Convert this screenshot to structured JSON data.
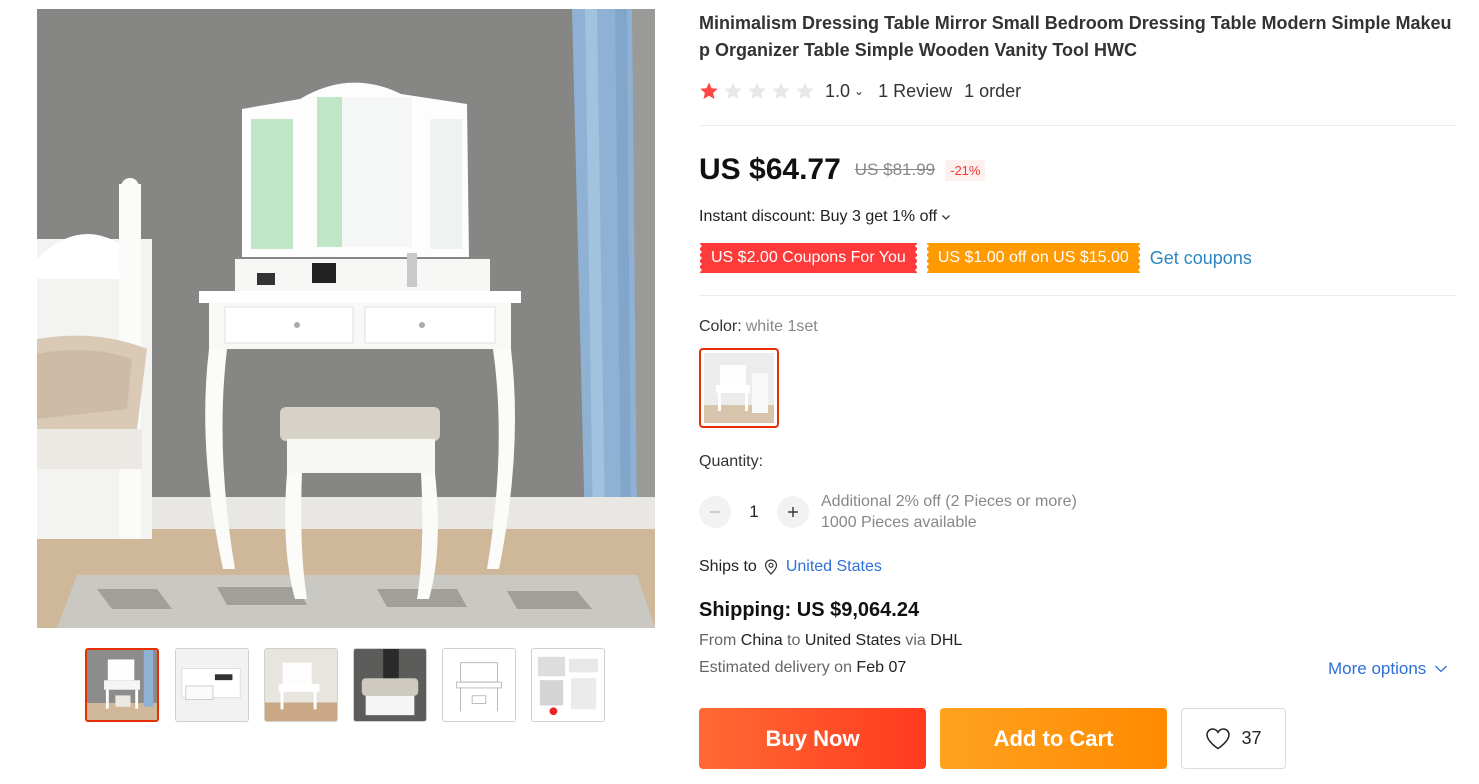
{
  "product": {
    "title": "Minimalism Dressing Table Mirror Small Bedroom Dressing Table Modern Simple Makeup Organizer Table Simple Wooden Vanity Tool HWC",
    "rating": {
      "value": "1.0",
      "stars_filled": 1,
      "stars_total": 5,
      "reviews_label": "1 Review",
      "orders_label": "1 order"
    },
    "price": {
      "current": "US $64.77",
      "original": "US $81.99",
      "discount": "-21%"
    },
    "instant_discount": "Instant discount: Buy 3 get 1% off",
    "coupons": [
      {
        "label": "US $2.00 Coupons For You",
        "color": "#ff3a3a"
      },
      {
        "label": "US $1.00 off on US $15.00",
        "color": "#ff9a00"
      }
    ],
    "get_coupons_label": "Get coupons",
    "color": {
      "label": "Color:",
      "value": "white 1set"
    },
    "quantity": {
      "label": "Quantity:",
      "value": "1",
      "decrement_icon": "minus-icon",
      "increment_icon": "plus-icon",
      "bulk_offer": "Additional 2% off (2 Pieces or more)",
      "available": "1000 Pieces available"
    },
    "shipping": {
      "ships_to_label": "Ships to",
      "ships_to_country": "United States",
      "cost_label": "Shipping: US $9,064.24",
      "route": {
        "from_word": "From",
        "from": "China",
        "to_word": "to",
        "to": "United States",
        "via_word": "via",
        "via": "DHL"
      },
      "delivery": {
        "prefix": "Estimated delivery on",
        "date": "Feb 07"
      },
      "more_options": "More options"
    },
    "actions": {
      "buy_now": "Buy Now",
      "add_to_cart": "Add to Cart",
      "wishlist_count": "37"
    },
    "gallery": {
      "selected_index": 0,
      "thumbnail_count": 6
    }
  },
  "colors": {
    "accent_red": "#e62e04",
    "buy_now": "#ff4b26",
    "add_to_cart": "#ff9a00",
    "link_blue": "#2e6fd8",
    "star_filled": "#ff4747",
    "star_empty": "#e8e8e8"
  }
}
